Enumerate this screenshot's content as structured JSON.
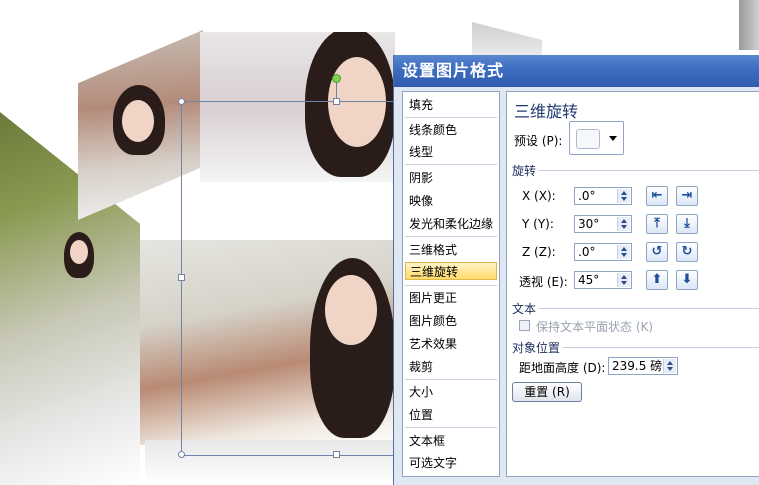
{
  "dialog": {
    "title": "设置图片格式",
    "nav_items": [
      "填充",
      "线条颜色",
      "线型",
      "阴影",
      "映像",
      "发光和柔化边缘",
      "三维格式",
      "三维旋转",
      "图片更正",
      "图片颜色",
      "艺术效果",
      "裁剪",
      "大小",
      "位置",
      "文本框",
      "可选文字"
    ],
    "active_item": "三维旋转",
    "section_title": "三维旋转",
    "preset_label": "预设 (P):",
    "rotation_group": "旋转",
    "x_label": "X (X):",
    "x_value": ".0°",
    "y_label": "Y (Y):",
    "y_value": "30°",
    "z_label": "Z (Z):",
    "z_value": ".0°",
    "perspective_label": "透视 (E):",
    "perspective_value": "45°",
    "text_group": "文本",
    "keep_text_flat_label": "保持文本平面状态 (K)",
    "object_position_group": "对象位置",
    "distance_label": "距地面高度 (D):",
    "distance_value": "239.5 磅",
    "reset_label": "重置 (R)"
  },
  "icons": {
    "x_left": "rotate-left-icon",
    "x_right": "rotate-right-icon",
    "y_up": "tilt-up-icon",
    "y_down": "tilt-down-icon",
    "z_ccw": "rotate-ccw-icon",
    "z_cw": "rotate-cw-icon",
    "persp_increase": "perspective-increase-icon",
    "persp_decrease": "perspective-decrease-icon"
  },
  "colors": {
    "titlebar": "#3c6cc0",
    "active_item": "#ffd96b",
    "selection_frame": "#6d84a6",
    "rotation_handle": "#7fd34a"
  }
}
